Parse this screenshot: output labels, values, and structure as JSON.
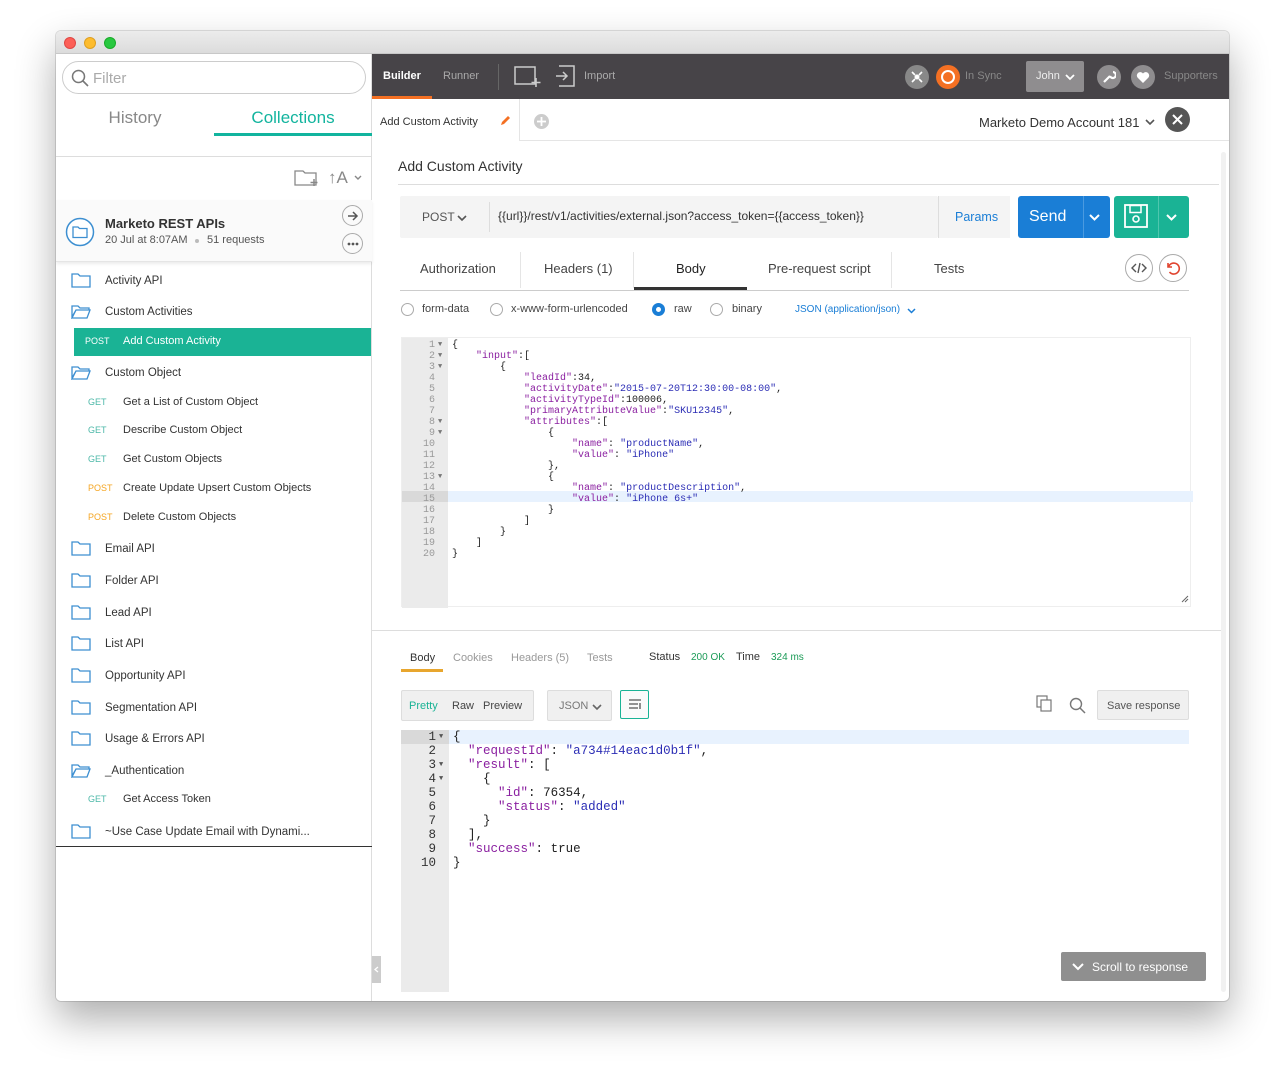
{
  "sidebar": {
    "filter_placeholder": "Filter",
    "tab_history": "History",
    "tab_collections": "Collections",
    "sort_label": "↑A",
    "collection": {
      "name": "Marketo REST APIs",
      "date": "20 Jul at 8:07AM",
      "count": "51 requests"
    },
    "items": [
      {
        "type": "folder",
        "label": "Activity API"
      },
      {
        "type": "folder-open",
        "label": "Custom Activities"
      },
      {
        "type": "request",
        "method": "POST",
        "label": "Add Custom Activity",
        "active": true
      },
      {
        "type": "folder-open",
        "label": "Custom Object"
      },
      {
        "type": "request",
        "method": "GET",
        "label": "Get a List of Custom Object"
      },
      {
        "type": "request",
        "method": "GET",
        "label": "Describe Custom Object"
      },
      {
        "type": "request",
        "method": "GET",
        "label": "Get Custom Objects"
      },
      {
        "type": "request",
        "method": "POST",
        "label": "Create Update Upsert Custom Objects"
      },
      {
        "type": "request",
        "method": "POST",
        "label": "Delete Custom Objects"
      },
      {
        "type": "folder",
        "label": "Email API"
      },
      {
        "type": "folder",
        "label": "Folder API"
      },
      {
        "type": "folder",
        "label": "Lead API"
      },
      {
        "type": "folder",
        "label": "List API"
      },
      {
        "type": "folder",
        "label": "Opportunity API"
      },
      {
        "type": "folder",
        "label": "Segmentation API"
      },
      {
        "type": "folder",
        "label": "Usage & Errors API"
      },
      {
        "type": "folder-open",
        "label": "_Authentication"
      },
      {
        "type": "request",
        "method": "GET",
        "label": "Get Access Token"
      },
      {
        "type": "folder",
        "label": "~Use Case Update Email with Dynami..."
      }
    ]
  },
  "topbar": {
    "builder": "Builder",
    "runner": "Runner",
    "import": "Import",
    "sync": "In Sync",
    "user": "John",
    "supporters": "Supporters"
  },
  "tab": {
    "name": "Add Custom Activity",
    "environment": "Marketo Demo Account 181"
  },
  "request": {
    "title": "Add Custom Activity",
    "method": "POST",
    "url": "{{url}}/rest/v1/activities/external.json?access_token={{access_token}}",
    "params": "Params",
    "send": "Send",
    "subtabs": [
      "Authorization",
      "Headers (1)",
      "Body",
      "Pre-request script",
      "Tests"
    ],
    "body_modes": [
      "form-data",
      "x-www-form-urlencoded",
      "raw",
      "binary"
    ],
    "content_type": "JSON (application/json)"
  },
  "code_lines": [
    "{",
    "    \"input\":[",
    "        {",
    "            \"leadId\":34,",
    "            \"activityDate\":\"2015-07-20T12:30:00-08:00\",",
    "            \"activityTypeId\":100006,",
    "            \"primaryAttributeValue\":\"SKU12345\",",
    "            \"attributes\":[",
    "                {",
    "                    \"name\": \"productName\",",
    "                    \"value\": \"iPhone\"",
    "                },",
    "                {",
    "                    \"name\": \"productDescription\",",
    "                    \"value\": \"iPhone 6s+\"",
    "                }",
    "            ]",
    "        }",
    "    ]",
    "}"
  ],
  "response": {
    "tabs": [
      "Body",
      "Cookies",
      "Headers (5)",
      "Tests"
    ],
    "status_label": "Status",
    "status": "200 OK",
    "time_label": "Time",
    "time": "324 ms",
    "views": [
      "Pretty",
      "Raw",
      "Preview"
    ],
    "format": "JSON",
    "save": "Save response",
    "scroll": "Scroll to response",
    "lines": [
      "{",
      "  \"requestId\": \"a734#14eac1d0b1f\",",
      "  \"result\": [",
      "    {",
      "      \"id\": 76354,",
      "      \"status\": \"added\"",
      "    }",
      "  ],",
      "  \"success\": true",
      "}"
    ]
  },
  "colors": {
    "teal": "#12b49e",
    "blue": "#1a7ed6",
    "save_green": "#1ab395",
    "dark_bar": "#474448",
    "get": "#4cb8a8",
    "post": "#f5a623"
  }
}
